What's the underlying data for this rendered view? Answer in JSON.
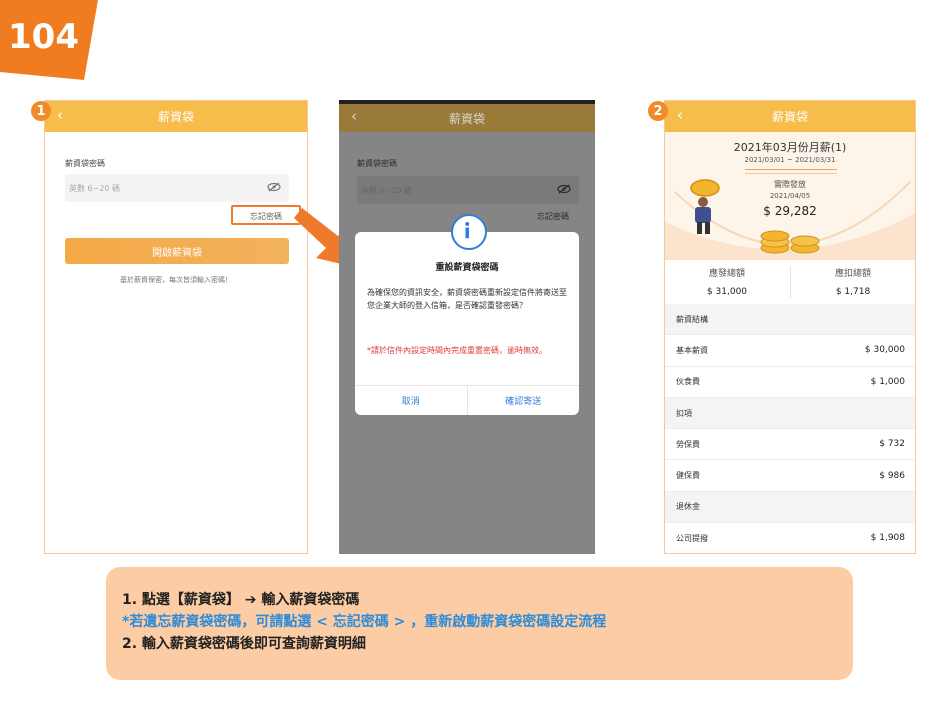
{
  "logo": {
    "text": "104"
  },
  "steps": {
    "one": "1",
    "two": "2"
  },
  "screen1": {
    "title": "薪資袋",
    "password_label": "薪資袋密碼",
    "password_placeholder": "英數 6~20 碼",
    "forgot_link": "忘記密碼",
    "open_button": "開啟薪資袋",
    "hint": "基於薪資保密，每次皆須輸入密碼！"
  },
  "screen2": {
    "title": "薪資袋",
    "password_label": "薪資袋密碼",
    "password_placeholder": "英數 6~20 碼",
    "forgot_link": "忘記密碼",
    "dialog": {
      "title": "重設薪資袋密碼",
      "body": "為確保您的資訊安全，薪資袋密碼重新設定信件將寄送至您企業大師的登入信箱，是否確認重發密碼？",
      "warning": "*請於信件內設定時間內完成重置密碼，逾時無效。",
      "cancel": "取消",
      "confirm": "確認寄送"
    }
  },
  "screen3": {
    "title": "薪資袋",
    "salary_title": "2021年03月份月薪(1)",
    "period": "2021/03/01 ~ 2021/03/31",
    "paid_label": "實際發放",
    "paid_date": "2021/04/05",
    "paid_amount": "$ 29,282",
    "gross_label": "應發總額",
    "gross_value": "$ 31,000",
    "deduct_label": "應扣總額",
    "deduct_value": "$ 1,718",
    "rows": [
      {
        "label": "薪資結構",
        "amount": "",
        "section": true
      },
      {
        "label": "基本薪資",
        "amount": "$ 30,000",
        "section": false
      },
      {
        "label": "伙食費",
        "amount": "$ 1,000",
        "section": false
      },
      {
        "label": "扣項",
        "amount": "",
        "section": true
      },
      {
        "label": "勞保費",
        "amount": "$ 732",
        "section": false
      },
      {
        "label": "健保費",
        "amount": "$ 986",
        "section": false
      },
      {
        "label": "退休金",
        "amount": "",
        "section": true
      },
      {
        "label": "公司提撥",
        "amount": "$ 1,908",
        "section": false
      }
    ]
  },
  "instructions": {
    "line1": "1. 點選【薪資袋】 ➔ 輸入薪資袋密碼",
    "line2": "*若遺忘薪資袋密碼，可請點選 < 忘記密碼 > ，重新啟動薪資袋密碼設定流程",
    "line3": "2. 輸入薪資袋密碼後即可查詢薪資明細"
  },
  "colors": {
    "accent": "#f6bd4b",
    "brand": "#f08a2b",
    "link_blue": "#2e7fd9",
    "warning_red": "#e03a3a",
    "panel": "#fccca4"
  }
}
